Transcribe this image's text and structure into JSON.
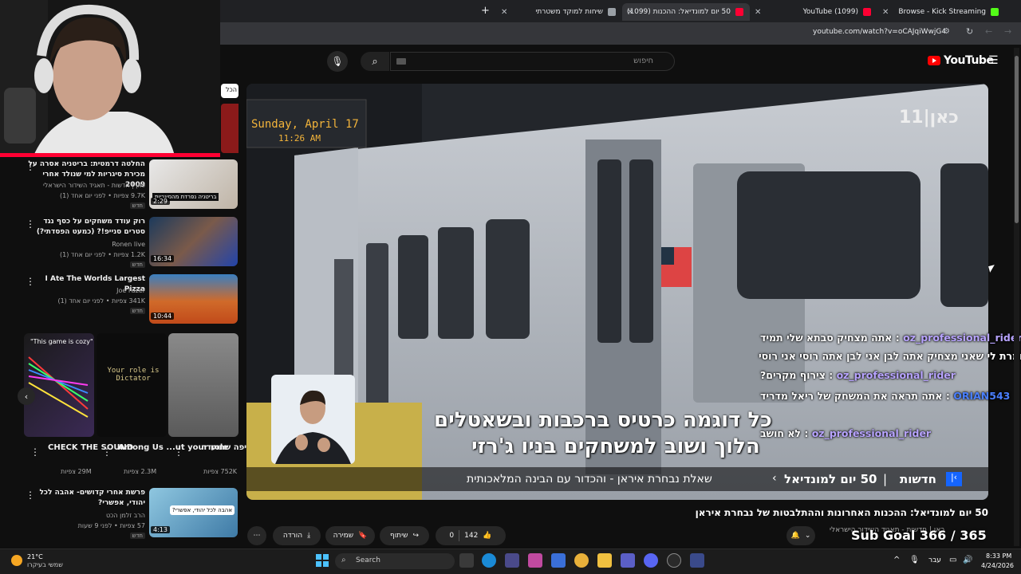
{
  "tabs": [
    {
      "label": "Browse - Kick Streaming",
      "color": "#53fc18"
    },
    {
      "label": "(1099) YouTube",
      "color": "#ff0033"
    },
    {
      "label": "50 יום למונדיאל: ההכנות (1099)",
      "color": "#ff0033"
    },
    {
      "label": "שיחות למוקד משטרתי",
      "color": "#9aa0a6"
    }
  ],
  "address": {
    "url": "youtube.com/watch?v=oCAJqiWwjG4"
  },
  "header": {
    "logo": "YouTube",
    "search_placeholder": "חיפוש"
  },
  "player": {
    "channel_logo": "כאן|11",
    "station_sign": "Sunday, April 17 11:26 AM",
    "subtitle_line1": "כל דוגמה כרטיס ברכבות ובשאטלים",
    "subtitle_line2": "הלוך ושוב למשחקים בניו ג'רזי",
    "ticker_label": "חדשות",
    "ticker_bold": "50 יום למונדיאל",
    "ticker_text": "שאלת נבחרת איראן - והכדור עם הבינה המלאכותית",
    "sub_goal": "Sub Goal 366 / 365"
  },
  "chat": [
    {
      "user": "oz_professional_rider",
      "message": "אתה מצחיק סבתא שלי תמיד",
      "color": "#b8a4ff"
    },
    {
      "user": "",
      "message": "אומרת לי שאני מצחיק אתה לבן אני לבן אתה רוסי אני רוסי",
      "color": "#b8a4ff"
    },
    {
      "user": "oz_professional_rider",
      "message": "צירוף מקרים?",
      "color": "#b8a4ff"
    },
    {
      "user": "ORIAN543",
      "message": "אתה תראה את המשחק של ריאל מדריד",
      "color": "#4a7fff"
    },
    {
      "user": "oz_professional_rider",
      "message": "לא חושב",
      "color": "#b8a4ff"
    }
  ],
  "video": {
    "title": "50 יום למונדיאל: ההכנות האחרונות וההתלבטות של נבחרת איראן",
    "channel": "כאן | חדשות - תאגיד השידור הישראלי",
    "likes": "142",
    "dislikes": "0",
    "share": "שיתוף",
    "save": "שמירה",
    "download": "הורדה"
  },
  "related": [
    {
      "title": "החלטה דרמטית: בריטניה אסרה על מכירת סיגריות למי שנולד אחרי 2009",
      "channel": "כאן | חדשות - תאגיד השידור הישראלי",
      "meta": "9.7K צפיות • לפני יום אחד (1)",
      "badge": "חדש",
      "duration": "2:29",
      "thumb_text": "בריטניה נפרדת מהסיגריות",
      "icon": "verified-icon"
    },
    {
      "title": "רוק עודד משחקים על כסף נגד סטרים סנייפ!? (כמעט הפסדתי?)",
      "channel": "Ronen live",
      "meta": "1.2K צפיות • לפני יום אחד (1)",
      "badge": "חדש",
      "duration": "16:34",
      "thumb_text": "",
      "icon": ""
    },
    {
      "title": "I Ate The Worlds Largest Pizza",
      "channel": "Joe Fazer",
      "meta": "341K צפיות • לפני יום אחד (1)",
      "badge": "חדש",
      "duration": "10:44",
      "thumb_text": "",
      "icon": "verified-icon"
    },
    {
      "title": "פרשת אחרי קדושים- אהבה לכל יהודי, אפשרי?",
      "channel": "הרב זלמן הכט",
      "meta": "57 צפיות • לפני 9 שעות",
      "badge": "חדש",
      "duration": "4:13",
      "thumb_text": "אהבה לכל יהודי, אפשרי?",
      "icon": ""
    }
  ],
  "shorts": [
    {
      "title": "CHECK THE SOUND",
      "views": "29M צפיות",
      "thumb_text": "\"This game is cozy\""
    },
    {
      "title": "Among Us ...ut your role",
      "views": "2.3M צפיות",
      "thumb_text": "Your role is Dictator"
    },
    {
      "title": "התקיפה שתועדה",
      "views": "752K צפיות",
      "thumb_text": ""
    }
  ],
  "chip": "הכל",
  "taskbar": {
    "weather_temp": "21°C",
    "weather_text": "שמשי בעיקרו",
    "search": "Search",
    "time": "8:33 PM",
    "date": "4/24/2026",
    "lang": "עבר"
  },
  "colors": {
    "accent": "#ff0000",
    "chat_user": "#b8a4ff"
  }
}
